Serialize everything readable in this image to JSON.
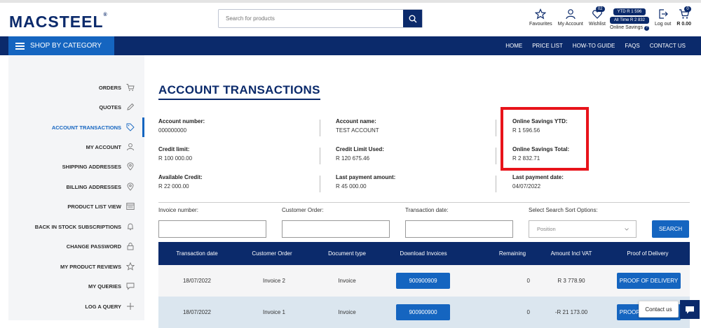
{
  "header": {
    "logo": "MACSTEEL",
    "search_placeholder": "Search for products",
    "icons": {
      "favourites": "Favourites",
      "account": "My Account",
      "wishlist": "Wishlist",
      "wishlist_count": "02",
      "savings_ytd": "YTD R 1 596",
      "savings_all": "All Time R 2 832",
      "online_savings": "Online Savings",
      "logout": "Log out",
      "cart_total": "R 0.00",
      "cart_count": "0"
    }
  },
  "nav": {
    "shop_by_category": "SHOP BY CATEGORY",
    "links": [
      "HOME",
      "PRICE LIST",
      "HOW-TO GUIDE",
      "FAQS",
      "CONTACT US"
    ]
  },
  "sidebar": {
    "items": [
      {
        "label": "ORDERS",
        "icon": "cart-icon"
      },
      {
        "label": "QUOTES",
        "icon": "pencil-icon"
      },
      {
        "label": "ACCOUNT TRANSACTIONS",
        "icon": "tag-icon"
      },
      {
        "label": "MY ACCOUNT",
        "icon": "user-icon"
      },
      {
        "label": "SHIPPING ADDRESSES",
        "icon": "location-icon"
      },
      {
        "label": "BILLING ADDRESSES",
        "icon": "location-icon"
      },
      {
        "label": "PRODUCT LIST VIEW",
        "icon": "list-view-icon"
      },
      {
        "label": "BACK IN STOCK SUBSCRIPTIONS",
        "icon": "bell-icon"
      },
      {
        "label": "CHANGE PASSWORD",
        "icon": "lock-icon"
      },
      {
        "label": "MY PRODUCT REVIEWS",
        "icon": "star-icon"
      },
      {
        "label": "MY QUERIES",
        "icon": "chat-icon"
      },
      {
        "label": "LOG A QUERY",
        "icon": "plus-icon"
      }
    ]
  },
  "page": {
    "title": "ACCOUNT TRANSACTIONS",
    "info": {
      "account_number_label": "Account number:",
      "account_number": "000000000",
      "account_name_label": "Account name:",
      "account_name": "TEST ACCOUNT",
      "savings_ytd_label": "Online Savings YTD:",
      "savings_ytd": "R 1 596.56",
      "credit_limit_label": "Credit limit:",
      "credit_limit": "R 100 000.00",
      "credit_used_label": "Credit Limit Used:",
      "credit_used": "R 120 675.46",
      "savings_total_label": "Online Savings Total:",
      "savings_total": "R 2 832.71",
      "available_credit_label": "Available Credit:",
      "available_credit": "R 22 000.00",
      "last_payment_amount_label": "Last payment amount:",
      "last_payment_amount": "R 45 000.00",
      "last_payment_date_label": "Last payment date:",
      "last_payment_date": "04/07/2022"
    },
    "filters": {
      "invoice_number": "Invoice number:",
      "customer_order": "Customer Order:",
      "transaction_date": "Transaction date:",
      "sort_label": "Select Search Sort Options:",
      "sort_selected": "Position",
      "search_button": "SEARCH"
    },
    "table": {
      "columns": [
        "Transaction date",
        "Customer Order",
        "Document type",
        "Download Invoices",
        "Remaining",
        "Amount Incl VAT",
        "Proof of Delivery"
      ],
      "rows": [
        {
          "date": "18/07/2022",
          "order": "Invoice 2",
          "type": "Invoice",
          "invoice": "900900909",
          "remaining": "0",
          "amount": "R 3 778.90",
          "pod": "PROOF OF DELIVERY"
        },
        {
          "date": "18/07/2022",
          "order": "Invoice 1",
          "type": "Invoice",
          "invoice": "900900900",
          "remaining": "0",
          "amount": "-R 21 173.00",
          "pod": "PROOF OF DELIVERY"
        }
      ]
    }
  },
  "widgets": {
    "contact_us": "Contact us"
  },
  "colors": {
    "brand_navy": "#0b2a6b",
    "accent_blue": "#1565c0",
    "highlight_red": "#e8131a"
  }
}
